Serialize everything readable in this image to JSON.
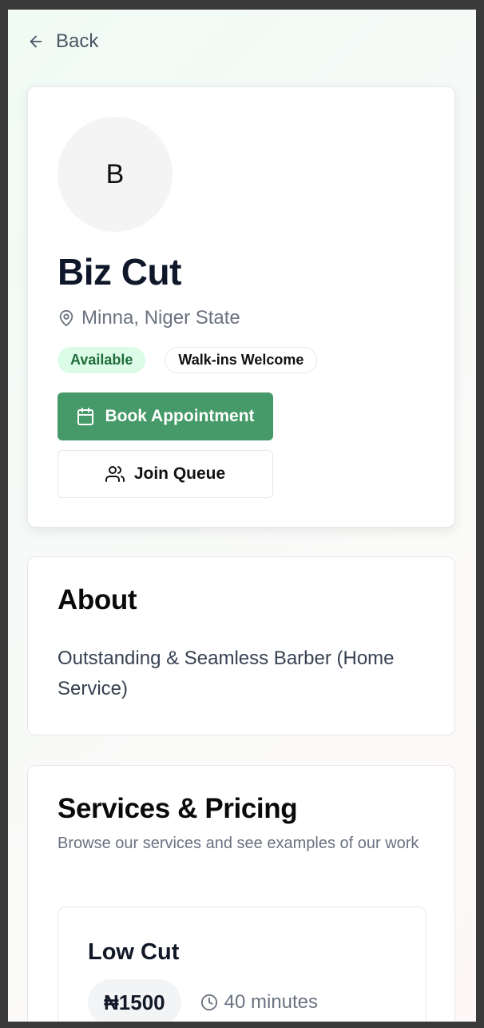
{
  "nav": {
    "back_label": "Back"
  },
  "profile": {
    "avatar_initial": "B",
    "name": "Biz Cut",
    "location": "Minna, Niger State",
    "badges": {
      "availability": "Available",
      "walkins": "Walk-ins Welcome"
    },
    "book_label": "Book Appointment",
    "queue_label": "Join Queue"
  },
  "about": {
    "title": "About",
    "text": "Outstanding & Seamless Barber (Home Service)"
  },
  "services": {
    "title": "Services & Pricing",
    "subtitle": "Browse our services and see examples of our work",
    "items": [
      {
        "name": "Low Cut",
        "price": "₦1500",
        "duration": "40 minutes"
      }
    ]
  },
  "colors": {
    "accent": "#469968",
    "badge_green_bg": "#dcfce7",
    "badge_green_text": "#1f6b3a"
  },
  "icons": [
    "arrow-left-icon",
    "map-pin-icon",
    "calendar-icon",
    "users-icon",
    "clock-icon"
  ]
}
